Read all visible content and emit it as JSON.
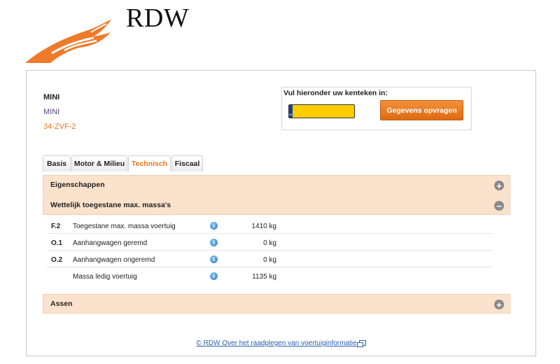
{
  "brand": {
    "logo_text": "RDW",
    "colors": {
      "accent": "#e5771e",
      "section_bg": "#fbe2cc"
    }
  },
  "vehicle": {
    "brand": "MINI",
    "model": "MINI",
    "plate": "34-ZVF-2"
  },
  "search": {
    "label": "Vul hieronder uw kenteken in:",
    "plate_country": "NL",
    "value": "",
    "button_label": "Gegevens opvragen"
  },
  "tabs": [
    {
      "label": "Basis",
      "active": false
    },
    {
      "label": "Motor & Milieu",
      "active": false
    },
    {
      "label": "Technisch",
      "active": true
    },
    {
      "label": "Fiscaal",
      "active": false
    }
  ],
  "sections": {
    "eigenschappen": {
      "title": "Eigenschappen",
      "toggle": "+",
      "expanded": false
    },
    "massa": {
      "title": "Wettelijk toegestane max. massa's",
      "toggle": "−",
      "expanded": true
    },
    "assen": {
      "title": "Assen",
      "toggle": "+",
      "expanded": false
    }
  },
  "massa_rows": [
    {
      "code": "F.2",
      "label": "Toegestane max. massa voertuig",
      "value": "1410 kg"
    },
    {
      "code": "O.1",
      "label": "Aanhangwagen geremd",
      "value": "0 kg"
    },
    {
      "code": "O.2",
      "label": "Aanhangwagen ongeremd",
      "value": "0 kg"
    },
    {
      "code": "",
      "label": "Massa ledig voertuig",
      "value": "1135 kg"
    }
  ],
  "info_icon_glyph": "i",
  "footer": {
    "link_text": "© RDW  Over het raadplegen van voertuiginformatie",
    "icon": "external-window-icon"
  }
}
